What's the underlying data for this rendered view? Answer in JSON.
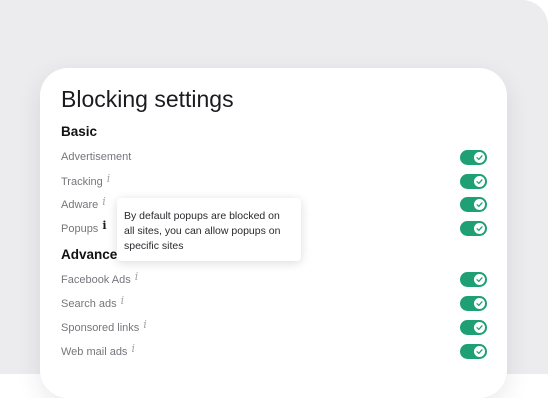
{
  "title": "Blocking settings",
  "sections": {
    "basic": {
      "title": "Basic",
      "items": [
        {
          "label": "Advertisement",
          "info_icon": false,
          "enabled": true
        },
        {
          "label": "Tracking",
          "info_icon": true,
          "enabled": true
        },
        {
          "label": "Adware",
          "info_icon": true,
          "enabled": true
        },
        {
          "label": "Popups",
          "info_icon": true,
          "enabled": true
        }
      ]
    },
    "advanced": {
      "title": "Advance",
      "items": [
        {
          "label": "Facebook Ads",
          "info_icon": true,
          "enabled": true
        },
        {
          "label": "Search ads",
          "info_icon": true,
          "enabled": true
        },
        {
          "label": "Sponsored links",
          "info_icon": true,
          "enabled": true
        },
        {
          "label": "Web mail ads",
          "info_icon": true,
          "enabled": true
        }
      ]
    }
  },
  "info_glyph": "i",
  "tooltip": {
    "text": "By default popups are blocked on all sites, you can allow popups on specific sites"
  },
  "colors": {
    "toggle_on": "#1ea074",
    "card_background": "#ffffff",
    "page_background": "#ececef",
    "label_text": "#76767c",
    "info_icon": "#a4a4aa"
  },
  "icons": {
    "info": "info-icon",
    "toggle_check": "checkmark-icon"
  }
}
